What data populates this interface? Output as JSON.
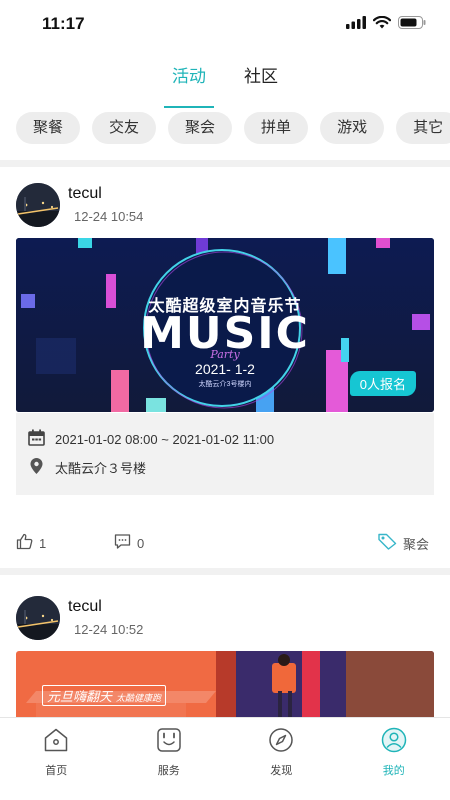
{
  "status": {
    "time": "11:17"
  },
  "top_tabs": [
    {
      "label": "活动",
      "active": true
    },
    {
      "label": "社区",
      "active": false
    }
  ],
  "chips": [
    "聚餐",
    "交友",
    "聚会",
    "拼单",
    "游戏",
    "其它"
  ],
  "posts": [
    {
      "author": "tecul",
      "time": "12-24 10:54",
      "banner": {
        "title": "太酷超级室内音乐节",
        "big_text": "MUSIC",
        "script_text": "Party",
        "date": "2021- 1-2",
        "venue_small": "太酷云介3号楼内"
      },
      "signup": "0人报名",
      "datetime": "2021-01-02 08:00 ~ 2021-01-02 11:00",
      "location": "太酷云介３号楼",
      "likes": "1",
      "comments": "0",
      "tag": "聚会"
    },
    {
      "author": "tecul",
      "time": "12-24 10:52",
      "banner": {
        "label": "元旦嗨翻天",
        "small_label": "太酷健康跑"
      }
    }
  ],
  "bottom_nav": [
    {
      "label": "首页",
      "icon": "home-icon",
      "active": false
    },
    {
      "label": "服务",
      "icon": "service-icon",
      "active": false
    },
    {
      "label": "发现",
      "icon": "compass-icon",
      "active": false
    },
    {
      "label": "我的",
      "icon": "profile-icon",
      "active": true
    }
  ],
  "colors": {
    "accent": "#1fb4b8",
    "badge": "#16c6d3"
  }
}
